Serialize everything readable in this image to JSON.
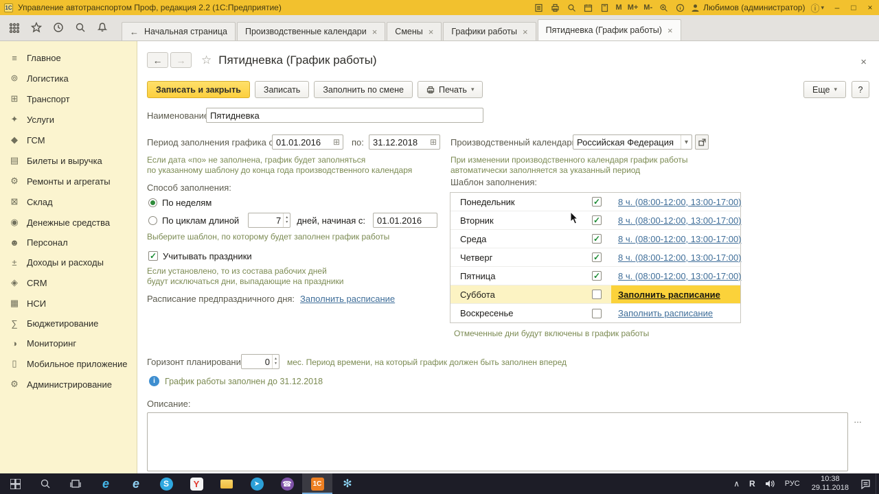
{
  "ui": {
    "caret": "▾",
    "spin_up": "▴",
    "spin_down": "▾",
    "dots": "…",
    "calendar_glyph": "⊞",
    "star": "☆",
    "back_arrow": "←",
    "fwd_arrow": "→",
    "close": "×",
    "chevron_up": "∧"
  },
  "colors": {
    "titlebar_yellow": "#f2c12e",
    "sidebar_yellow": "#fbf4cf",
    "primary_button": "#fccf3e",
    "selected_cell": "#fbd23a",
    "selected_row": "#fcf3c3",
    "link": "#3f6e99",
    "hint_green": "#7b8a52",
    "check_green": "#1d8c35",
    "taskbar_dark": "#1d1d27"
  },
  "title_bar": {
    "app_title": "Управление автотранспортом Проф, редакция 2.2 (1С:Предприятие)",
    "memory_buttons": [
      "M",
      "M+",
      "M-"
    ],
    "user": "Любимов (администратор)",
    "help_glyph": "ⓘ",
    "window_controls": {
      "minimize": "–",
      "maximize": "□",
      "close": "×"
    }
  },
  "tabbar": {
    "close_glyph": "×",
    "tabs": [
      {
        "label": "Начальная страница",
        "icon": "←",
        "closable": false,
        "active": false
      },
      {
        "label": "Производственные календари",
        "closable": true,
        "active": false
      },
      {
        "label": "Смены",
        "closable": true,
        "active": false
      },
      {
        "label": "Графики работы",
        "closable": true,
        "active": false
      },
      {
        "label": "Пятидневка (График работы)",
        "closable": true,
        "active": true
      }
    ]
  },
  "sidebar": {
    "items": [
      {
        "label": "Главное",
        "icon": "≡"
      },
      {
        "label": "Логистика",
        "icon": "⊚"
      },
      {
        "label": "Транспорт",
        "icon": "⊞"
      },
      {
        "label": "Услуги",
        "icon": "✦"
      },
      {
        "label": "ГСМ",
        "icon": "◆"
      },
      {
        "label": "Билеты и выручка",
        "icon": "▤"
      },
      {
        "label": "Ремонты и агрегаты",
        "icon": "⚙"
      },
      {
        "label": "Склад",
        "icon": "⊠"
      },
      {
        "label": "Денежные средства",
        "icon": "◉"
      },
      {
        "label": "Персонал",
        "icon": "☻"
      },
      {
        "label": "Доходы и расходы",
        "icon": "±"
      },
      {
        "label": "CRM",
        "icon": "◈"
      },
      {
        "label": "НСИ",
        "icon": "▦"
      },
      {
        "label": "Бюджетирование",
        "icon": "∑"
      },
      {
        "label": "Мониторинг",
        "icon": "◑"
      },
      {
        "label": "Мобильное приложение",
        "icon": "▯"
      },
      {
        "label": "Администрирование",
        "icon": "⚙"
      }
    ]
  },
  "form": {
    "title": "Пятидневка (График работы)",
    "close_glyph": "×",
    "toolbar": {
      "save_close": "Записать и закрыть",
      "save": "Записать",
      "fill_by_shift": "Заполнить по смене",
      "print": "Печать",
      "more": "Еще",
      "help": "?"
    },
    "fields": {
      "name_label": "Наименование:",
      "name_value": "Пятидневка",
      "period_label": "Период заполнения графика с:",
      "period_from": "01.01.2016",
      "period_to_label": "по:",
      "period_to": "31.12.2018",
      "calendar_label": "Производственный календарь:",
      "calendar_value": "Российская Федерация"
    },
    "hints": {
      "period_line1": "Если дата «по» не заполнена, график будет заполняться",
      "period_line2": "по указанному шаблону до конца года производственного календаря",
      "calendar_line1": "При изменении производственного календаря график работы",
      "calendar_line2": "автоматически заполняется за указанный период",
      "template_choose": "Выберите шаблон, по которому будет заполнен график работы",
      "holidays_line1": "Если установлено, то из состава рабочих дней",
      "holidays_line2": "будут исключаться дни, выпадающие на праздники",
      "template_footer": "Отмеченные дни будут включены в график работы",
      "horizon": "мес. Период времени, на который график должен быть заполнен вперед"
    },
    "fill_method": {
      "label": "Способ заполнения:",
      "by_weeks": {
        "label": "По неделям",
        "selected": true
      },
      "by_cycles": {
        "label": "По циклам длиной",
        "selected": false,
        "length": "7",
        "suffix": "дней,  начиная с:",
        "start": "01.01.2016"
      }
    },
    "holidays": {
      "label": "Учитывать праздники",
      "checked": true
    },
    "pre_holiday": {
      "label": "Расписание предпраздничного дня:",
      "link": "Заполнить расписание"
    },
    "template": {
      "label": "Шаблон заполнения:",
      "rows": [
        {
          "day": "Понедельник",
          "checked": true,
          "schedule": "8 ч. (08:00-12:00, 13:00-17:00)",
          "selected": false
        },
        {
          "day": "Вторник",
          "checked": true,
          "schedule": "8 ч. (08:00-12:00, 13:00-17:00)",
          "selected": false
        },
        {
          "day": "Среда",
          "checked": true,
          "schedule": "8 ч. (08:00-12:00, 13:00-17:00)",
          "selected": false
        },
        {
          "day": "Четверг",
          "checked": true,
          "schedule": "8 ч. (08:00-12:00, 13:00-17:00)",
          "selected": false
        },
        {
          "day": "Пятница",
          "checked": true,
          "schedule": "8 ч. (08:00-12:00, 13:00-17:00)",
          "selected": false
        },
        {
          "day": "Суббота",
          "checked": false,
          "schedule": "Заполнить расписание",
          "selected": true
        },
        {
          "day": "Воскресенье",
          "checked": false,
          "schedule": "Заполнить расписание",
          "selected": false
        }
      ]
    },
    "horizon": {
      "label": "Горизонт планирования:",
      "value": "0"
    },
    "filled_info": "График работы заполнен до 31.12.2018",
    "description_label": "Описание:"
  },
  "taskbar": {
    "apps": [
      {
        "name": "edge",
        "glyph": "e",
        "style": "color:#45b6e8;font-weight:bold;font-style:italic;font-size:18px"
      },
      {
        "name": "ie",
        "glyph": "e",
        "style": "color:#8fd0f2;font-weight:bold;font-style:italic;font-size:18px"
      },
      {
        "name": "skype",
        "glyph": "S",
        "style": "background:#2fa8e0;color:#fff;border-radius:50%;width:19px;height:19px;font-size:12px;font-weight:bold"
      },
      {
        "name": "yandex",
        "glyph": "Y",
        "style": "background:#f5f5f5;color:#e23a2e;border-radius:4px;width:19px;height:19px;font-size:13px;font-weight:bold"
      },
      {
        "name": "explorer",
        "glyph": "",
        "style": "background:linear-gradient(#f9d56a,#eebb3f);width:18px;height:13px;border-radius:2px"
      },
      {
        "name": "telegram",
        "glyph": "➤",
        "style": "background:#2ca0d8;color:#fff;border-radius:50%;width:19px;height:19px;font-size:10px"
      },
      {
        "name": "viber",
        "glyph": "☎",
        "style": "background:#7f53a8;color:#fff;border-radius:50%;width:19px;height:19px;font-size:11px"
      },
      {
        "name": "onec",
        "glyph": "1С",
        "style": "background:#ee8022;color:#fff;border-radius:3px;width:19px;height:19px;font-size:10px;font-weight:bold",
        "active": true
      },
      {
        "name": "snowflake",
        "glyph": "✻",
        "style": "color:#8fd8f8;font-size:16px"
      }
    ],
    "tray": {
      "chevron": "∧",
      "app_badge": "R",
      "lang": "РУС",
      "time": "10:38",
      "date": "29.11.2018"
    }
  }
}
